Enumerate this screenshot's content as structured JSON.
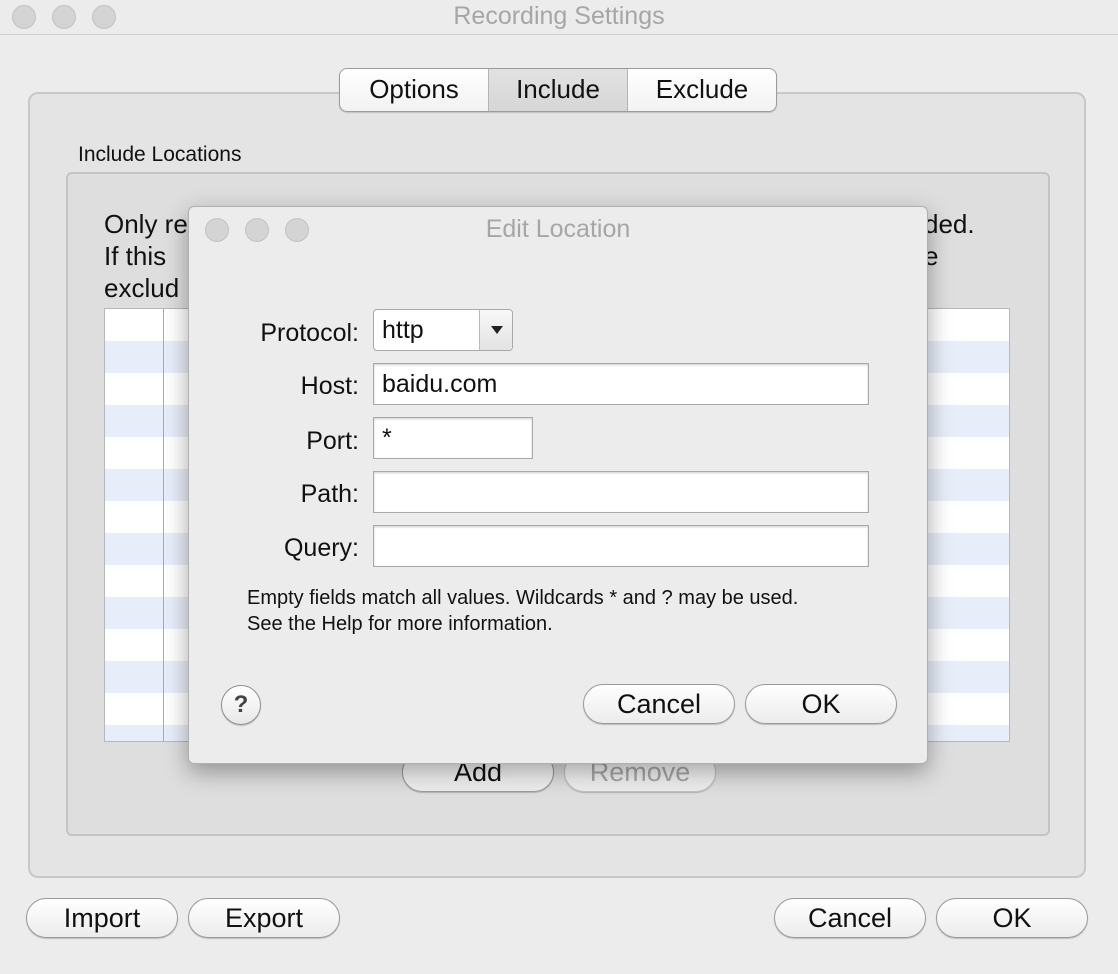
{
  "window": {
    "title": "Recording Settings"
  },
  "tabs": [
    {
      "label": "Options"
    },
    {
      "label": "Include"
    },
    {
      "label": "Exclude"
    }
  ],
  "include_panel": {
    "group_label": "Include Locations",
    "description_lines": [
      "Only re",
      "If this",
      "exclud"
    ],
    "description_right": [
      "ded.",
      "e"
    ],
    "add_label": "Add",
    "remove_label": "Remove"
  },
  "footer": {
    "import_label": "Import",
    "export_label": "Export",
    "cancel_label": "Cancel",
    "ok_label": "OK"
  },
  "dialog": {
    "title": "Edit Location",
    "protocol_label": "Protocol:",
    "protocol_value": "http",
    "host_label": "Host:",
    "host_value": "baidu.com",
    "port_label": "Port:",
    "port_value": "*",
    "path_label": "Path:",
    "path_value": "",
    "query_label": "Query:",
    "query_value": "",
    "hint_line1": "Empty fields match all values. Wildcards * and ? may be used.",
    "hint_line2": "See the Help for more information.",
    "help_label": "?",
    "cancel_label": "Cancel",
    "ok_label": "OK"
  }
}
